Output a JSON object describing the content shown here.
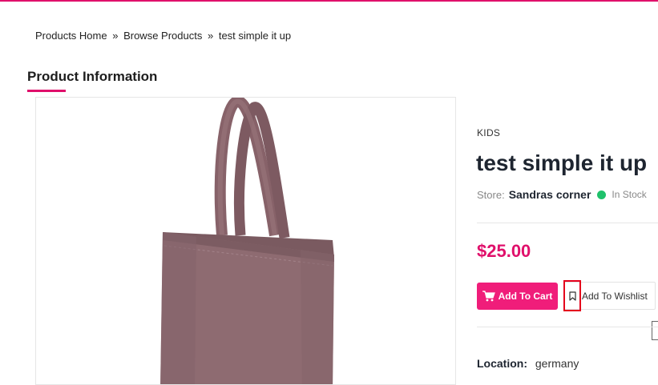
{
  "breadcrumb": {
    "home": "Products Home",
    "sep1": "»",
    "browse": "Browse Products",
    "sep2": "»",
    "current": "test simple it up"
  },
  "section": {
    "title": "Product Information"
  },
  "product": {
    "image_icon": "tote-bag-image",
    "category": "KIDS",
    "title": "test simple it up",
    "store_label": "Store:",
    "store_name": "Sandras corner",
    "stock_status": "In Stock",
    "price": "$25.00",
    "add_to_cart_label": "Add To Cart",
    "add_to_wishlist_label": "Add To Wishlist",
    "location_label": "Location:",
    "location_value": "germany"
  },
  "colors": {
    "accent": "#e0106b",
    "cart_button": "#f01d7a",
    "in_stock": "#1fc16b",
    "highlight_box": "#e4001c"
  },
  "icons": {
    "cart": "shopping-cart-icon",
    "wishlist": "bookmark-icon",
    "stock": "status-dot-icon"
  }
}
